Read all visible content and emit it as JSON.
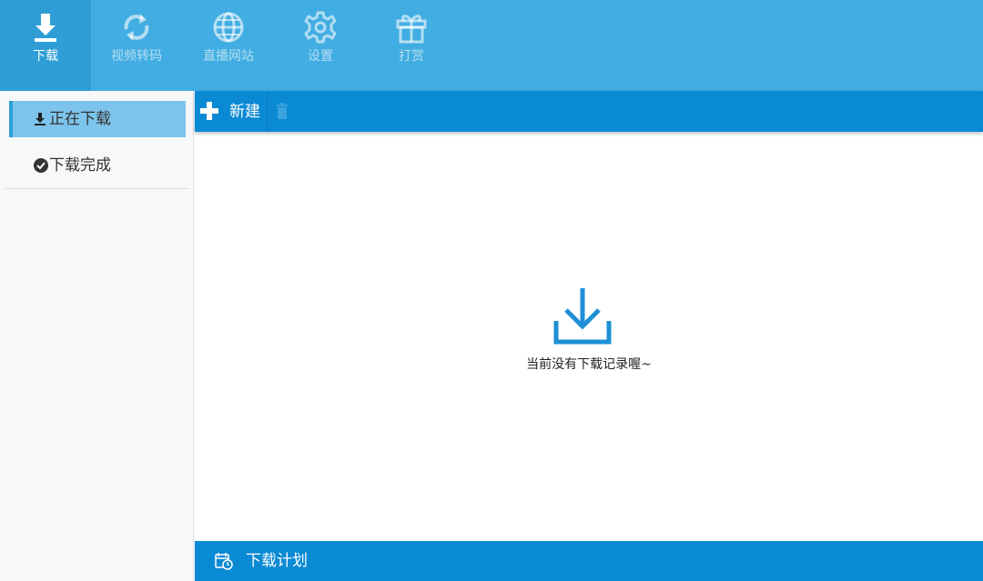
{
  "top_nav": {
    "items": [
      {
        "label": "下载",
        "icon": "download-icon",
        "active": true
      },
      {
        "label": "视频转码",
        "icon": "convert-icon",
        "active": false
      },
      {
        "label": "直播网站",
        "icon": "globe-icon",
        "active": false
      },
      {
        "label": "设置",
        "icon": "gear-icon",
        "active": false
      },
      {
        "label": "打赏",
        "icon": "gift-icon",
        "active": false
      }
    ]
  },
  "sidebar": {
    "items": [
      {
        "label": "正在下载",
        "icon": "download-icon",
        "active": true
      },
      {
        "label": "下载完成",
        "icon": "check-circle-icon",
        "active": false
      }
    ]
  },
  "toolbar": {
    "new_label": "新建",
    "new_icon": "plus-icon",
    "delete_icon": "trash-icon"
  },
  "content": {
    "empty_icon": "download-tray-icon",
    "empty_message": "当前没有下载记录喔~"
  },
  "bottom_bar": {
    "label": "下载计划",
    "icon": "calendar-clock-icon"
  },
  "colors": {
    "topbar": "#41ade2",
    "topbar_active": "#2f9ed6",
    "toolbar": "#0a8ad4",
    "sidebar_active": "#7cc4ec",
    "accent_icon": "#1e90d6"
  }
}
